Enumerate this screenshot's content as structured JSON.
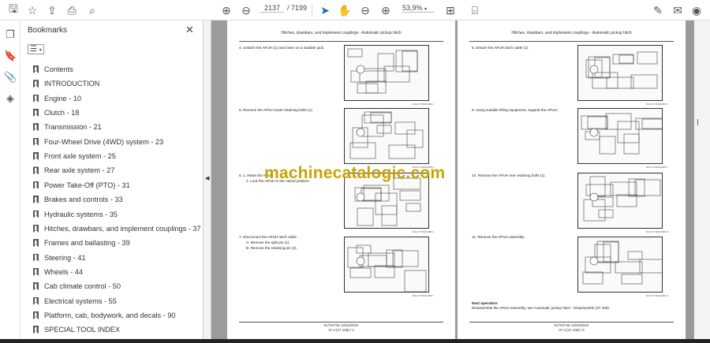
{
  "toolbar": {
    "page_current": "2137",
    "page_total": "/ 7199",
    "zoom": "53,9%"
  },
  "bookmarks": {
    "title": "Bookmarks",
    "items": [
      "Contents",
      "INTRODUCTION",
      "Engine - 10",
      "Clutch - 18",
      "Transmission - 21",
      "Four-Wheel Drive (4WD) system - 23",
      "Front axle system - 25",
      "Rear axle system - 27",
      "Power Take-Off (PTO) - 31",
      "Brakes and controls - 33",
      "Hydraulic systems - 35",
      "Hitches, drawbars, and implement couplings - 37",
      "Frames and ballasting - 39",
      "Steering - 41",
      "Wheels - 44",
      "Cab climate control - 50",
      "Electrical systems - 55",
      "Platform, cab, bodywork, and decals - 90",
      "SPECIAL TOOL INDEX"
    ]
  },
  "left_page": {
    "header": "Hitches, drawbars, and implement couplings - Automatic pickup hitch",
    "steps": [
      "4.  Unlatch the APUH (1) and lower on a suitable jack.",
      "5.  Remove the APUH lower retaining bolts (1).",
      "6.  1.  Raise the APUH.",
      "2.  Lock the APUH in the raised position.",
      "7.  Disconnect the APUH latch cable:",
      "A.  Remove the split pin (1).",
      "B.  Remove the retaining pin (2)."
    ],
    "captions": [
      "RAIL17TR01049B   4",
      "RAIL17TR01050B   5",
      "RAIL17TR01048B   6",
      "RAIL17TR01046B   7"
    ],
    "footer_1": "91764746 12/04/2022",
    "footer_2": "37.2 [37.106] / 4"
  },
  "right_page": {
    "header": "Hitches, drawbars, and implement couplings - Automatic pickup hitch",
    "steps": [
      "8.  Detach the APUH latch cable (1).",
      "9.  Using suitable lifting equipment, support the APUH.",
      "10.  Remove the APUH rear retaining bolts (1).",
      "11.  Remove the APUH assembly."
    ],
    "captions": [
      "RAIL17TR01045B   8",
      "RAIL17TR01044B   9",
      "RAIL17TR01043B   10",
      "RAIL17TR01042B   11"
    ],
    "next_label": "Next operation:",
    "next_text": "Disassemble the APUH assembly, see Automatic pickup hitch - Disassemble (37.106).",
    "footer_1": "91764746 12/04/2022",
    "footer_2": "37.2 [37.106] / 5"
  },
  "watermark": "machinecatalogic.com"
}
